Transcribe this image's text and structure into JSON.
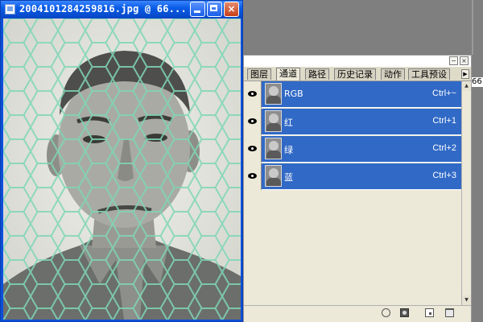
{
  "image_window": {
    "title": "2004101284259816.jpg @ 66...",
    "icon": "document-icon",
    "controls": {
      "minimize": "minimize-icon",
      "maximize": "maximize-icon",
      "close": "×"
    }
  },
  "panel": {
    "controls": {
      "minimize": "−",
      "close": "×",
      "menu_arrow": "▶"
    },
    "tabs": [
      {
        "label": "图层",
        "active": false
      },
      {
        "label": "通道",
        "active": true
      },
      {
        "label": "路径",
        "active": false
      },
      {
        "label": "历史记录",
        "active": false
      },
      {
        "label": "动作",
        "active": false
      },
      {
        "label": "工具预设",
        "active": false
      }
    ],
    "channels": [
      {
        "name": "RGB",
        "shortcut": "Ctrl+~",
        "visible": true,
        "selected": true
      },
      {
        "name": "红",
        "shortcut": "Ctrl+1",
        "visible": true,
        "selected": true
      },
      {
        "name": "绿",
        "shortcut": "Ctrl+2",
        "visible": true,
        "selected": true
      },
      {
        "name": "蓝",
        "shortcut": "Ctrl+3",
        "visible": true,
        "selected": true
      }
    ],
    "footer_icons": [
      "load-selection-icon",
      "save-mask-icon",
      "new-channel-icon",
      "delete-channel-icon"
    ],
    "scroll": {
      "up": "▲",
      "down": "▼"
    }
  },
  "zoom_readout": "66",
  "colors": {
    "titlebar_blue": "#0a5ce6",
    "selection_blue": "#3169c6",
    "panel_bg": "#ece9d8",
    "workspace_gray": "#7f7f7f",
    "net_green": "#7fd6b8"
  }
}
